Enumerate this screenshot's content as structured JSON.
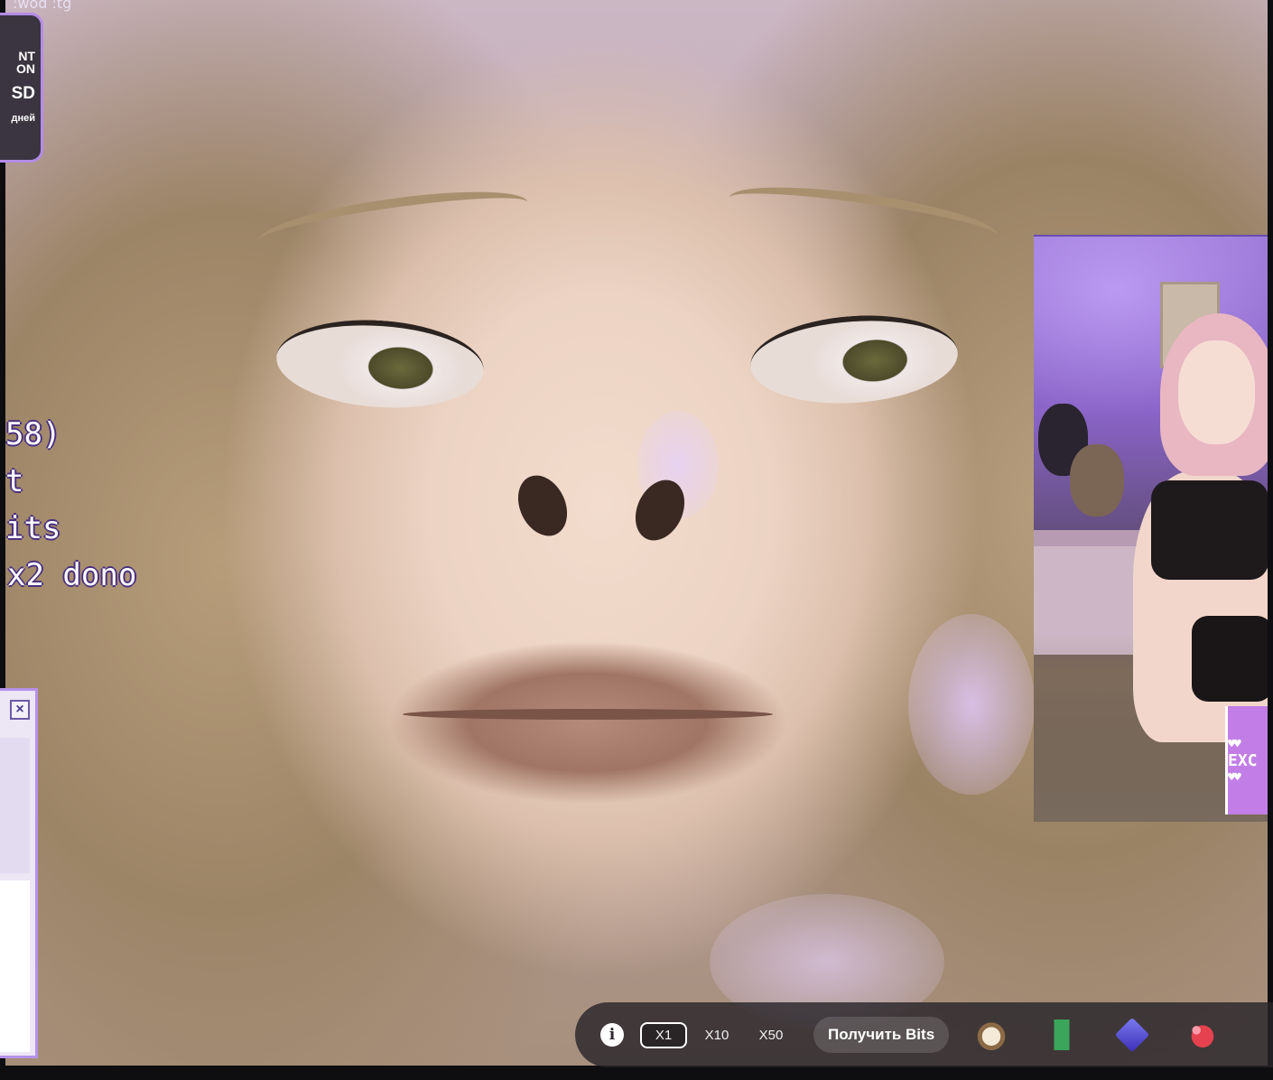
{
  "overlay": {
    "watermark": ":wod :tg"
  },
  "sub_card": {
    "line1": "NT",
    "line2": "ON",
    "line3": "SD",
    "line4": "дней"
  },
  "goal_text": {
    "line1": "58)",
    "line2": "t",
    "line3": "its",
    "line4": "x2 dono"
  },
  "retro_window": {
    "close_label": "×"
  },
  "pip": {
    "badge_text": "EXC",
    "hearts_top": "♥♥",
    "hearts_bottom": "♥♥"
  },
  "bits_bar": {
    "info_label": "i",
    "multipliers": [
      "X1",
      "X10",
      "X50"
    ],
    "selected_multiplier": "X1",
    "get_bits_label": "Получить Bits",
    "emotes": [
      "dog-emote",
      "bottle-emote",
      "gem-emote",
      "heart-emote"
    ]
  }
}
